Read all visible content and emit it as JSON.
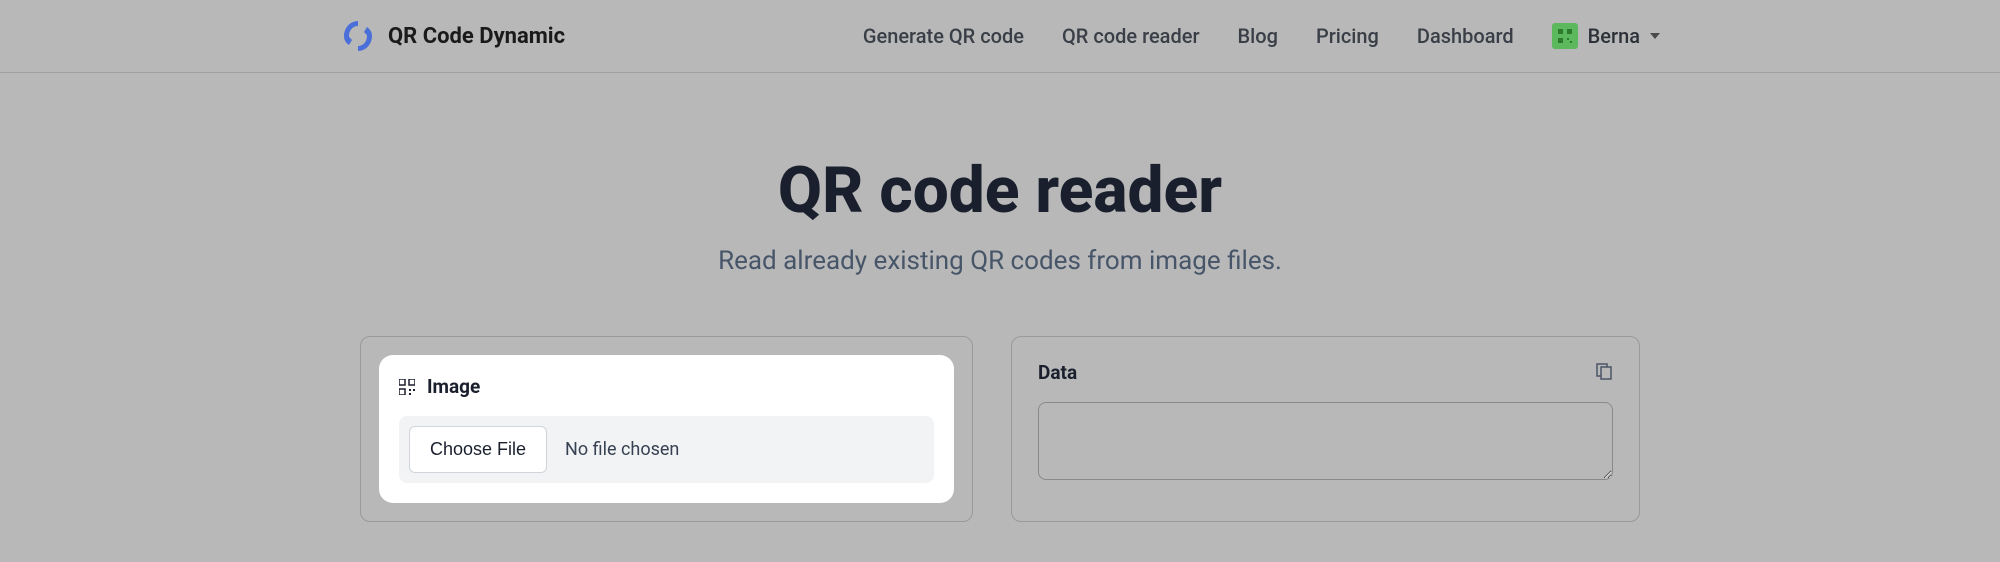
{
  "header": {
    "brand": "QR Code Dynamic",
    "nav": {
      "generate": "Generate QR code",
      "reader": "QR code reader",
      "blog": "Blog",
      "pricing": "Pricing",
      "dashboard": "Dashboard"
    },
    "user": {
      "name": "Berna"
    }
  },
  "hero": {
    "title": "QR code reader",
    "subtitle": "Read already existing QR codes from image files."
  },
  "upload": {
    "label": "Image",
    "choose_file": "Choose File",
    "no_file": "No file chosen"
  },
  "data": {
    "label": "Data",
    "value": ""
  }
}
